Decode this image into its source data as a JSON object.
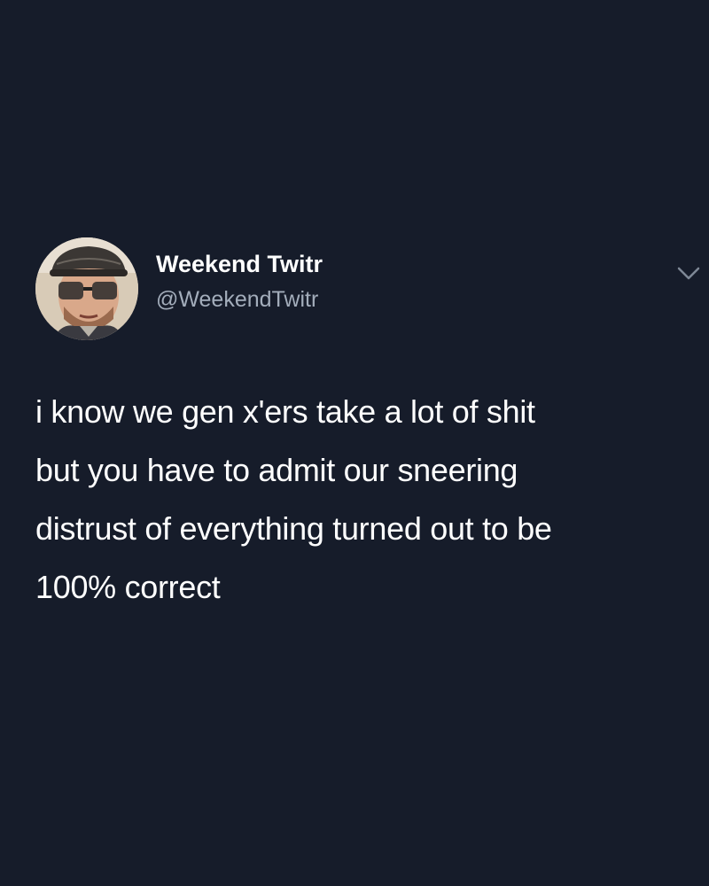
{
  "tweet": {
    "author": {
      "display_name": "Weekend Twitr",
      "handle": "@WeekendTwitr",
      "avatar_icon": "profile-photo"
    },
    "menu_icon": "chevron-down-icon",
    "text": "i know we gen x'ers take a lot of shit\nbut you have to admit our sneering\ndistrust of everything turned out to be\n100% correct"
  },
  "colors": {
    "background": "#161c2a",
    "text": "#ffffff",
    "handle": "#a3adbb",
    "chevron": "#7e8896"
  }
}
